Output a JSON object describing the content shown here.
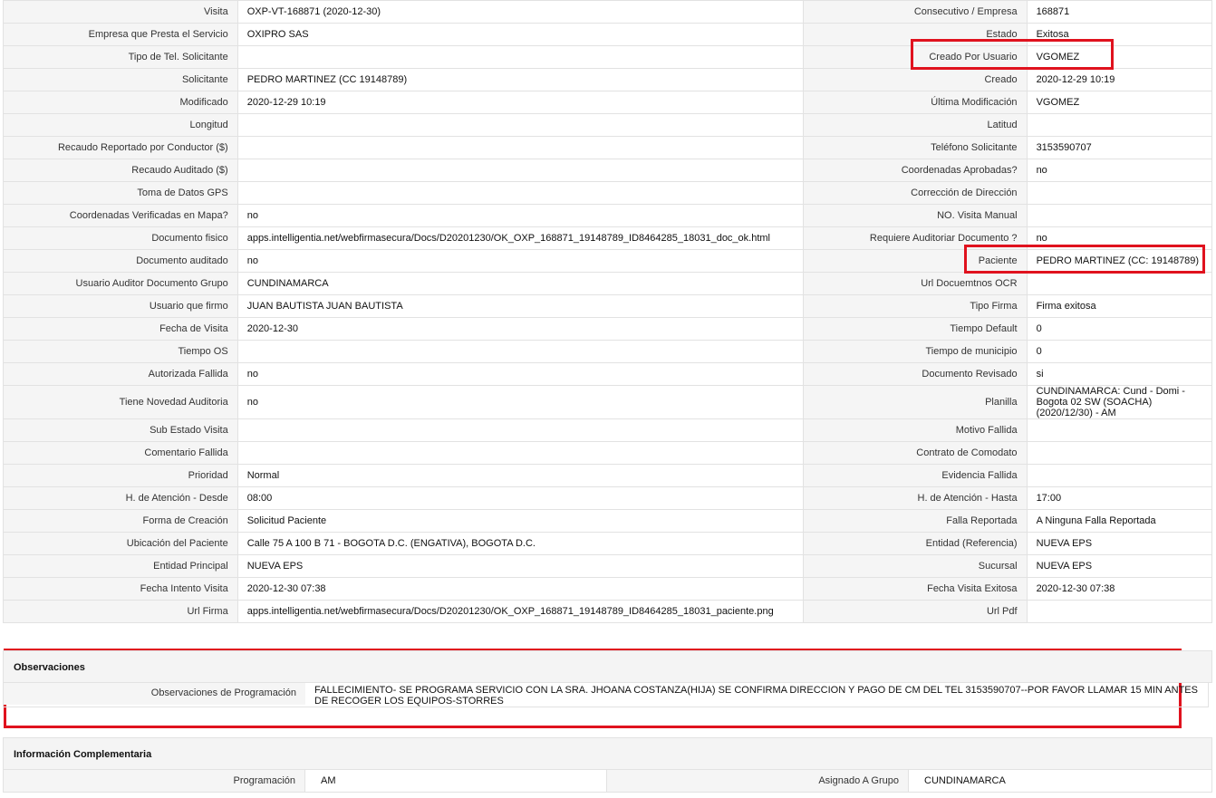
{
  "rows": [
    {
      "l1": "Visita",
      "v1": "OXP-VT-168871 (2020-12-30)",
      "l2": "Consecutivo / Empresa",
      "v2": "168871"
    },
    {
      "l1": "Empresa que Presta el Servicio",
      "v1": "OXIPRO SAS",
      "l2": "Estado",
      "v2": "Exitosa"
    },
    {
      "l1": "Tipo de Tel. Solicitante",
      "v1": "",
      "l2": "Creado Por Usuario",
      "v2": "VGOMEZ"
    },
    {
      "l1": "Solicitante",
      "v1": "PEDRO MARTINEZ (CC 19148789)",
      "l2": "Creado",
      "v2": "2020-12-29 10:19"
    },
    {
      "l1": "Modificado",
      "v1": "2020-12-29 10:19",
      "l2": "Última Modificación",
      "v2": "VGOMEZ"
    },
    {
      "l1": "Longitud",
      "v1": "",
      "l2": "Latitud",
      "v2": ""
    },
    {
      "l1": "Recaudo Reportado por Conductor ($)",
      "v1": "",
      "l2": "Teléfono Solicitante",
      "v2": "3153590707"
    },
    {
      "l1": "Recaudo Auditado ($)",
      "v1": "",
      "l2": "Coordenadas Aprobadas?",
      "v2": "no"
    },
    {
      "l1": "Toma de Datos GPS",
      "v1": "",
      "l2": "Corrección de Dirección",
      "v2": ""
    },
    {
      "l1": "Coordenadas Verificadas en Mapa?",
      "v1": "no",
      "l2": "NO. Visita Manual",
      "v2": ""
    },
    {
      "l1": "Documento fisico",
      "v1": "apps.intelligentia.net/webfirmasecura/Docs/D20201230/OK_OXP_168871_19148789_ID8464285_18031_doc_ok.html",
      "l2": "Requiere Auditoriar Documento ?",
      "v2": "no"
    },
    {
      "l1": "Documento auditado",
      "v1": "no",
      "l2": "Paciente",
      "v2": "PEDRO MARTINEZ (CC: 19148789)"
    },
    {
      "l1": "Usuario Auditor Documento Grupo",
      "v1": "CUNDINAMARCA",
      "l2": "Url Docuemtnos OCR",
      "v2": ""
    },
    {
      "l1": "Usuario que firmo",
      "v1": "JUAN BAUTISTA JUAN BAUTISTA",
      "l2": "Tipo Firma",
      "v2": "Firma exitosa"
    },
    {
      "l1": "Fecha de Visita",
      "v1": "2020-12-30",
      "l2": "Tiempo Default",
      "v2": "0"
    },
    {
      "l1": "Tiempo OS",
      "v1": "",
      "l2": "Tiempo de municipio",
      "v2": "0"
    },
    {
      "l1": "Autorizada Fallida",
      "v1": "no",
      "l2": "Documento Revisado",
      "v2": "si"
    },
    {
      "l1": "Tiene Novedad Auditoria",
      "v1": "no",
      "l2": "Planilla",
      "v2": "CUNDINAMARCA: Cund - Domi - Bogota 02 SW (SOACHA) (2020/12/30) - AM"
    },
    {
      "l1": "Sub Estado Visita",
      "v1": "",
      "l2": "Motivo Fallida",
      "v2": ""
    },
    {
      "l1": "Comentario Fallida",
      "v1": "",
      "l2": "Contrato de Comodato",
      "v2": ""
    },
    {
      "l1": "Prioridad",
      "v1": "Normal",
      "l2": "Evidencia Fallida",
      "v2": ""
    },
    {
      "l1": "H. de Atención - Desde",
      "v1": "08:00",
      "l2": "H. de Atención - Hasta",
      "v2": "17:00"
    },
    {
      "l1": "Forma de Creación",
      "v1": "Solicitud Paciente",
      "l2": "Falla Reportada",
      "v2": "A Ninguna Falla Reportada"
    },
    {
      "l1": "Ubicación del Paciente",
      "v1": "Calle 75 A 100 B 71 - BOGOTA D.C. (ENGATIVA), BOGOTA D.C.",
      "l2": "Entidad (Referencia)",
      "v2": "NUEVA EPS"
    },
    {
      "l1": "Entidad Principal",
      "v1": "NUEVA EPS",
      "l2": "Sucursal",
      "v2": "NUEVA EPS"
    },
    {
      "l1": "Fecha Intento Visita",
      "v1": "2020-12-30 07:38",
      "l2": "Fecha Visita Exitosa",
      "v2": "2020-12-30 07:38"
    },
    {
      "l1": "Url Firma",
      "v1": "apps.intelligentia.net/webfirmasecura/Docs/D20201230/OK_OXP_168871_19148789_ID8464285_18031_paciente.png",
      "l2": "Url Pdf",
      "v2": ""
    }
  ],
  "observaciones": {
    "title": "Observaciones",
    "label": "Observaciones de Programación",
    "value": "FALLECIMIENTO- SE PROGRAMA SERVICIO CON LA SRA. JHOANA COSTANZA(HIJA) SE CONFIRMA DIRECCION Y PAGO DE CM DEL TEL 3153590707--POR FAVOR LLAMAR 15 MIN ANTES DE RECOGER LOS EQUIPOS-STORRES"
  },
  "complementaria": {
    "title": "Información Complementaria",
    "l1": "Programación",
    "v1": "AM",
    "l2": "Asignado A Grupo",
    "v2": "CUNDINAMARCA"
  },
  "colors": {
    "highlight": "#e0121e"
  }
}
